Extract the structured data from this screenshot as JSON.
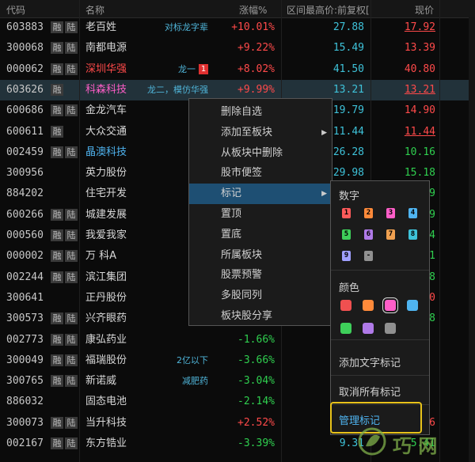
{
  "header": {
    "code": "代码",
    "name": "名称",
    "change": "涨幅%",
    "range_high": "区间最高价:前复权[",
    "price": "现价"
  },
  "rows": [
    {
      "code": "603883",
      "rong": "融",
      "lu": "陆",
      "name": "老百姓",
      "name_color": "#d8d8d8",
      "tag": "对标龙字辈",
      "change": "+10.01%",
      "dir": "up",
      "high": "27.88",
      "price": "17.92",
      "price_dir": "up",
      "price_ul": true
    },
    {
      "code": "300068",
      "rong": "融",
      "lu": "陆",
      "name": "南都电源",
      "name_color": "#d8d8d8",
      "tag": "",
      "change": "+9.22%",
      "dir": "up",
      "high": "15.49",
      "price": "13.39",
      "price_dir": "up",
      "price_ul": false
    },
    {
      "code": "000062",
      "rong": "融",
      "lu": "陆",
      "name": "深圳华强",
      "name_color": "#ff4a4a",
      "tag": "龙一",
      "tag_badge": "1",
      "change": "+8.02%",
      "dir": "up",
      "high": "41.50",
      "price": "40.80",
      "price_dir": "up",
      "price_ul": false
    },
    {
      "code": "603626",
      "rong": "融",
      "lu": "",
      "name": "科森科技",
      "name_color": "#ff5ec8",
      "tag": "龙二，模仿华强",
      "change": "+9.99%",
      "dir": "up",
      "high": "13.21",
      "price": "13.21",
      "price_dir": "up",
      "price_ul": true,
      "selected": true
    },
    {
      "code": "600686",
      "rong": "融",
      "lu": "陆",
      "name": "金龙汽车",
      "name_color": "#d8d8d8",
      "tag": "",
      "change": "",
      "dir": "up",
      "high": "19.79",
      "price": "14.90",
      "price_dir": "up",
      "price_ul": false
    },
    {
      "code": "600611",
      "rong": "融",
      "lu": "",
      "name": "大众交通",
      "name_color": "#d8d8d8",
      "tag": "",
      "change": "",
      "dir": "up",
      "high": "11.44",
      "price": "11.44",
      "price_dir": "up",
      "price_ul": true
    },
    {
      "code": "002459",
      "rong": "融",
      "lu": "陆",
      "name": "晶澳科技",
      "name_color": "#4fb4f0",
      "tag": "",
      "change": "",
      "dir": "dn",
      "high": "26.28",
      "price": "10.16",
      "price_dir": "dn",
      "price_ul": false
    },
    {
      "code": "300956",
      "rong": "",
      "lu": "",
      "name": "英力股份",
      "name_color": "#d8d8d8",
      "tag": "",
      "change": "",
      "dir": "dn",
      "high": "29.98",
      "price": "15.18",
      "price_dir": "dn",
      "price_ul": false
    },
    {
      "code": "884202",
      "rong": "",
      "lu": "",
      "name": "住宅开发",
      "name_color": "#d8d8d8",
      "tag": "",
      "change": "",
      "dir": "dn",
      "high": "",
      "price": "9",
      "price_dir": "dn",
      "price_ul": false
    },
    {
      "code": "600266",
      "rong": "融",
      "lu": "陆",
      "name": "城建发展",
      "name_color": "#d8d8d8",
      "tag": "",
      "change": "",
      "dir": "dn",
      "high": "",
      "price": "9",
      "price_dir": "dn",
      "price_ul": false
    },
    {
      "code": "000560",
      "rong": "融",
      "lu": "陆",
      "name": "我爱我家",
      "name_color": "#d8d8d8",
      "tag": "",
      "change": "",
      "dir": "dn",
      "high": "",
      "price": "4",
      "price_dir": "dn",
      "price_ul": false
    },
    {
      "code": "000002",
      "rong": "融",
      "lu": "陆",
      "name": "万  科A",
      "name_color": "#d8d8d8",
      "tag": "",
      "change": "",
      "dir": "dn",
      "high": "",
      "price": "1",
      "price_dir": "dn",
      "price_ul": false
    },
    {
      "code": "002244",
      "rong": "融",
      "lu": "陆",
      "name": "滨江集团",
      "name_color": "#d8d8d8",
      "tag": "",
      "change": "",
      "dir": "dn",
      "high": "",
      "price": "8",
      "price_dir": "dn",
      "price_ul": false
    },
    {
      "code": "300641",
      "rong": "",
      "lu": "",
      "name": "正丹股份",
      "name_color": "#d8d8d8",
      "tag": "",
      "change": "",
      "dir": "up",
      "high": "",
      "price": "0",
      "price_dir": "up",
      "price_ul": false
    },
    {
      "code": "300573",
      "rong": "融",
      "lu": "陆",
      "name": "兴齐眼药",
      "name_color": "#d8d8d8",
      "tag": "",
      "change": "",
      "dir": "dn",
      "high": "",
      "price": "8",
      "price_dir": "dn",
      "price_ul": false
    },
    {
      "code": "002773",
      "rong": "融",
      "lu": "陆",
      "name": "康弘药业",
      "name_color": "#d8d8d8",
      "tag": "",
      "change": "-1.66%",
      "dir": "dn",
      "high": "",
      "price": "",
      "price_dir": "dn",
      "price_ul": false
    },
    {
      "code": "300049",
      "rong": "融",
      "lu": "陆",
      "name": "福瑞股份",
      "name_color": "#d8d8d8",
      "tag": "2亿以下",
      "change": "-3.66%",
      "dir": "dn",
      "high": "",
      "price": "",
      "price_dir": "dn",
      "price_ul": false
    },
    {
      "code": "300765",
      "rong": "融",
      "lu": "陆",
      "name": "新诺威",
      "name_color": "#d8d8d8",
      "tag": "减肥药",
      "change": "-3.04%",
      "dir": "dn",
      "high": "",
      "price": "",
      "price_dir": "dn",
      "price_ul": false
    },
    {
      "code": "886032",
      "rong": "",
      "lu": "",
      "name": "固态电池",
      "name_color": "#d8d8d8",
      "tag": "",
      "change": "-2.14%",
      "dir": "dn",
      "high": "",
      "price": "",
      "price_dir": "dn",
      "price_ul": false
    },
    {
      "code": "300073",
      "rong": "融",
      "lu": "陆",
      "name": "当升科技",
      "name_color": "#d8d8d8",
      "tag": "",
      "change": "+2.52%",
      "dir": "up",
      "high": "",
      "price": "6",
      "price_dir": "up",
      "price_ul": false
    },
    {
      "code": "002167",
      "rong": "融",
      "lu": "陆",
      "name": "东方锆业",
      "name_color": "#d8d8d8",
      "tag": "",
      "change": "-3.39%",
      "dir": "dn",
      "high": "9.31",
      "price": "5.41",
      "price_dir": "dn",
      "price_ul": false
    }
  ],
  "context_menu": {
    "items": [
      {
        "label": "删除自选",
        "has_sub": false
      },
      {
        "label": "添加至板块",
        "has_sub": true
      },
      {
        "label": "从板块中删除",
        "has_sub": false
      },
      {
        "label": "股市便签",
        "has_sub": false
      },
      {
        "label": "标记",
        "has_sub": true,
        "active": true
      },
      {
        "label": "置顶",
        "has_sub": false
      },
      {
        "label": "置底",
        "has_sub": false
      },
      {
        "label": "所属板块",
        "has_sub": false
      },
      {
        "label": "股票预警",
        "has_sub": false
      },
      {
        "label": "多股同列",
        "has_sub": false
      },
      {
        "label": "板块股分享",
        "has_sub": false
      }
    ]
  },
  "mark_submenu": {
    "digits_title": "数字",
    "digits": [
      {
        "label": "1",
        "color": "#ff5a5a"
      },
      {
        "label": "2",
        "color": "#ff8a3a"
      },
      {
        "label": "3",
        "color": "#ff5ec8"
      },
      {
        "label": "4",
        "color": "#4fb4f0"
      },
      {
        "label": "5",
        "color": "#3ecf5a"
      },
      {
        "label": "6",
        "color": "#b07ae8"
      },
      {
        "label": "7",
        "color": "#f0a050"
      },
      {
        "label": "8",
        "color": "#3ec2d9"
      },
      {
        "label": "9",
        "color": "#a0a0ff"
      },
      {
        "label": "-",
        "color": "#909090"
      }
    ],
    "colors_title": "颜色",
    "colors": [
      "#f05050",
      "#ff8a3a",
      "#ff5ec8",
      "#4fb4f0",
      "#3ecf5a",
      "#b07ae8",
      "#909090"
    ],
    "add_text_mark": "添加文字标记",
    "cancel_all_marks": "取消所有标记",
    "manage_marks": "管理标记"
  },
  "watermark": {
    "text": "巧 网"
  }
}
